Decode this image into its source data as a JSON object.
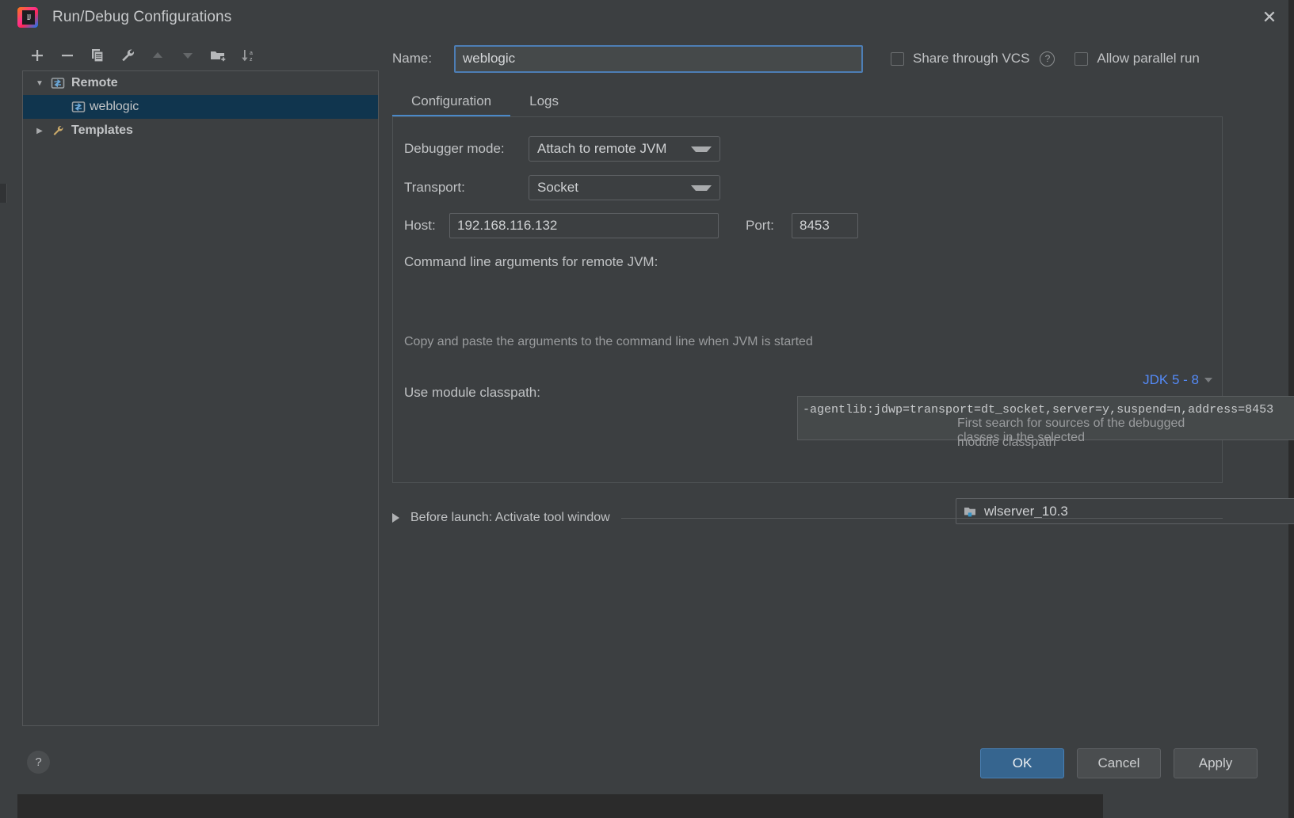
{
  "window": {
    "title": "Run/Debug Configurations",
    "logo_icon": "intellij-idea-logo",
    "logo_text": "IJ",
    "close_icon": "close-icon"
  },
  "toolbar": {
    "buttons": [
      {
        "name": "add-configuration-button",
        "icon": "plus-icon",
        "enabled": true
      },
      {
        "name": "remove-configuration-button",
        "icon": "minus-icon",
        "enabled": true
      },
      {
        "name": "copy-configuration-button",
        "icon": "copy-icon",
        "enabled": true
      },
      {
        "name": "edit-templates-button",
        "icon": "wrench-icon",
        "enabled": true
      },
      {
        "name": "move-up-button",
        "icon": "arrow-up-icon",
        "enabled": false
      },
      {
        "name": "move-down-button",
        "icon": "arrow-down-icon",
        "enabled": false
      },
      {
        "name": "new-folder-button",
        "icon": "new-folder-icon",
        "enabled": true
      },
      {
        "name": "sort-alphabetically-button",
        "icon": "sort-az-icon",
        "enabled": true
      }
    ]
  },
  "tree": {
    "nodes": [
      {
        "label": "Remote",
        "icon": "remote-config-icon",
        "expanded": true,
        "selected": false,
        "depth": 0,
        "twisty": "▼"
      },
      {
        "label": "weblogic",
        "icon": "remote-config-icon",
        "expanded": false,
        "selected": true,
        "depth": 1,
        "twisty": ""
      },
      {
        "label": "Templates",
        "icon": "wrench-icon",
        "expanded": false,
        "selected": false,
        "depth": 0,
        "twisty": "▶"
      }
    ]
  },
  "header": {
    "name_label": "Name:",
    "name_value": "weblogic",
    "name_placeholder": "Name",
    "share_vcs_label": "Share through VCS",
    "share_vcs_checked": false,
    "help_icon": "help-icon",
    "help_glyph": "?",
    "allow_parallel_label": "Allow parallel run",
    "allow_parallel_checked": false
  },
  "tabs": [
    {
      "label": "Configuration",
      "active": true
    },
    {
      "label": "Logs",
      "active": false
    }
  ],
  "configuration": {
    "debugger_mode_label": "Debugger mode:",
    "debugger_mode_value": "Attach to remote JVM",
    "transport_label": "Transport:",
    "transport_value": "Socket",
    "host_label": "Host:",
    "host_value": "192.168.116.132",
    "port_label": "Port:",
    "port_value": "8453",
    "cmdline_label": "Command line arguments for remote JVM:",
    "jdk_selector_label": "JDK 5 - 8",
    "jdk_selector_icon": "chevron-down-icon",
    "cmdline_value": "-agentlib:jdwp=transport=dt_socket,server=y,suspend=n,address=8453",
    "cmdline_hint": "Copy and paste the arguments to the command line when JVM is started",
    "module_classpath_label": "Use module classpath:",
    "module_classpath_value": "wlserver_10.3",
    "module_classpath_icon": "module-folder-icon",
    "module_classpath_hint_line1": "First search for sources of the debugged classes in the selected",
    "module_classpath_hint_line2": "module classpath"
  },
  "before_launch": {
    "label": "Before launch: Activate tool window",
    "expanded": false,
    "twisty_icon": "triangle-right-icon"
  },
  "footer": {
    "help_icon": "help-icon",
    "help_glyph": "?",
    "ok_label": "OK",
    "cancel_label": "Cancel",
    "apply_label": "Apply"
  },
  "colors": {
    "background": "#3c3f41",
    "panel_border": "#4e5254",
    "selection": "#10354e",
    "accent_blue": "#4a88c7",
    "link_blue": "#548af7",
    "primary_button": "#36658f",
    "field_background": "#45494a",
    "text": "#c0c2c4",
    "muted_text": "#9a9c9e"
  }
}
